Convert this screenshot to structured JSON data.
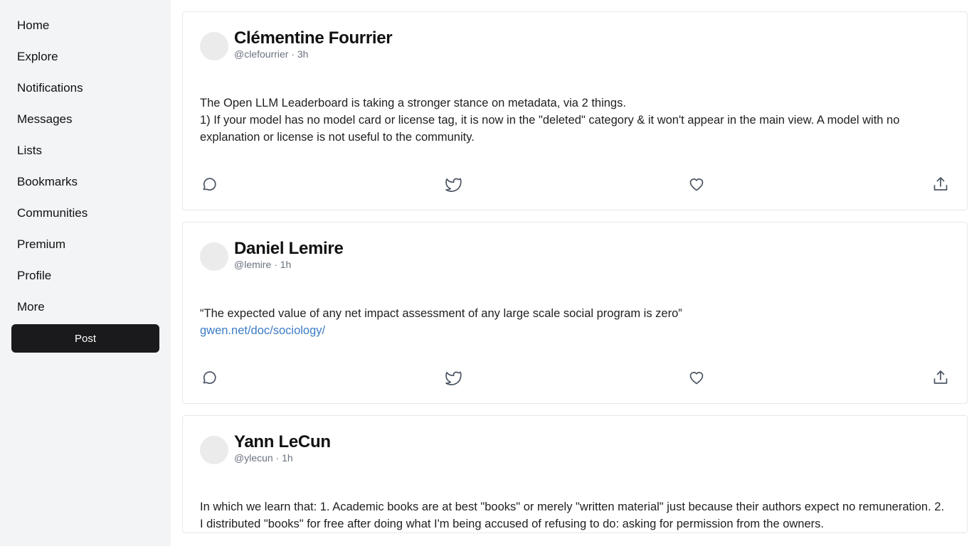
{
  "sidebar": {
    "items": [
      {
        "label": "Home"
      },
      {
        "label": "Explore"
      },
      {
        "label": "Notifications"
      },
      {
        "label": "Messages"
      },
      {
        "label": "Lists"
      },
      {
        "label": "Bookmarks"
      },
      {
        "label": "Communities"
      },
      {
        "label": "Premium"
      },
      {
        "label": "Profile"
      },
      {
        "label": "More"
      }
    ],
    "post_button": "Post"
  },
  "feed": {
    "posts": [
      {
        "author": "Clémentine Fourrier",
        "meta": "@clefourrier · 3h",
        "lines": [
          "The Open LLM Leaderboard is taking a stronger stance on metadata, via 2 things.",
          "1) If your model has no model card or license tag, it is now in the \"deleted\" category & it won't appear in the main view. A model with no explanation or license is not useful to the community."
        ]
      },
      {
        "author": "Daniel Lemire",
        "meta": "@lemire · 1h",
        "lines": [
          "“The expected value of any net impact assessment of any large scale social program is zero”"
        ],
        "link": "gwen.net/doc/sociology/"
      },
      {
        "author": "Yann LeCun",
        "meta": "@ylecun · 1h",
        "lines": [
          "In which we learn that: 1. Academic books are at best \"books\" or merely \"written material\" just because their authors expect no remuneration. 2. I distributed \"books\" for free after doing what I'm being accused of refusing to do: asking for permission from the owners."
        ]
      }
    ]
  },
  "icons": {
    "reply": "speech-bubble-icon",
    "repost": "bird-icon",
    "like": "heart-icon",
    "share": "share-upload-icon"
  }
}
